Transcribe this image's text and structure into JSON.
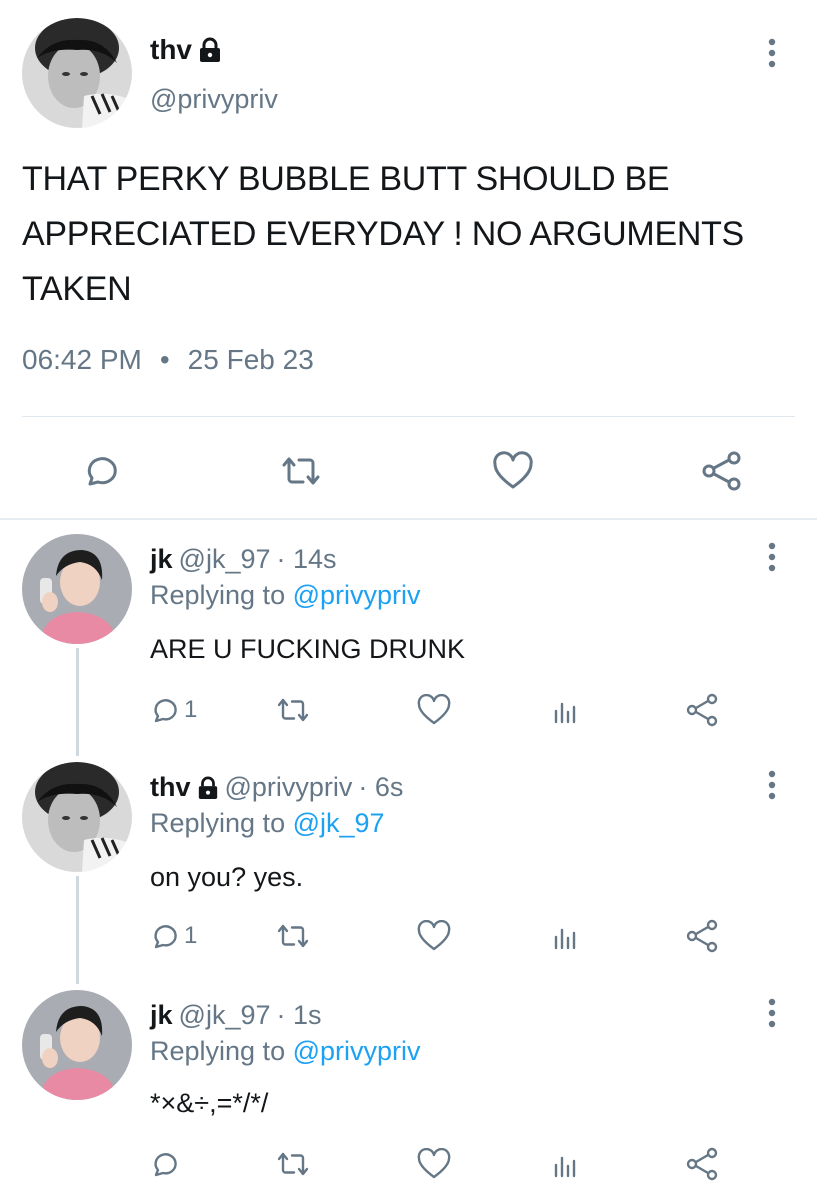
{
  "main_tweet": {
    "name": "thv",
    "handle": "@privypriv",
    "text": "THAT PERKY BUBBLE BUTT SHOULD BE APPRECIATED EVERYDAY ! NO ARGUMENTS TAKEN",
    "time": "06:42 PM",
    "separator": "•",
    "date": "25 Feb 23"
  },
  "replies": [
    {
      "name": "jk",
      "handle": "@jk_97",
      "age": "· 14s",
      "replying_prefix": "Replying to",
      "replying_to": "@privypriv",
      "text": "ARE U FUCKING DRUNK",
      "reply_count": "1"
    },
    {
      "name": "thv",
      "handle": "@privypriv",
      "age": "· 6s",
      "replying_prefix": "Replying to",
      "replying_to": "@jk_97",
      "text": "on you? yes.",
      "reply_count": "1"
    },
    {
      "name": "jk",
      "handle": "@jk_97",
      "age": "· 1s",
      "replying_prefix": "Replying to",
      "replying_to": "@privypriv",
      "text": "*×&÷,=*/*/",
      "reply_count": ""
    }
  ],
  "colors": {
    "text_primary": "#14171a",
    "text_secondary": "#657786",
    "link": "#1da1f2",
    "divider": "#e1e8ed"
  },
  "icons": {
    "lock": "lock-icon",
    "more": "more-vertical-icon",
    "reply": "reply-bubble-icon",
    "retweet": "retweet-icon",
    "like": "heart-icon",
    "analytics": "analytics-bars-icon",
    "share": "share-icon"
  }
}
